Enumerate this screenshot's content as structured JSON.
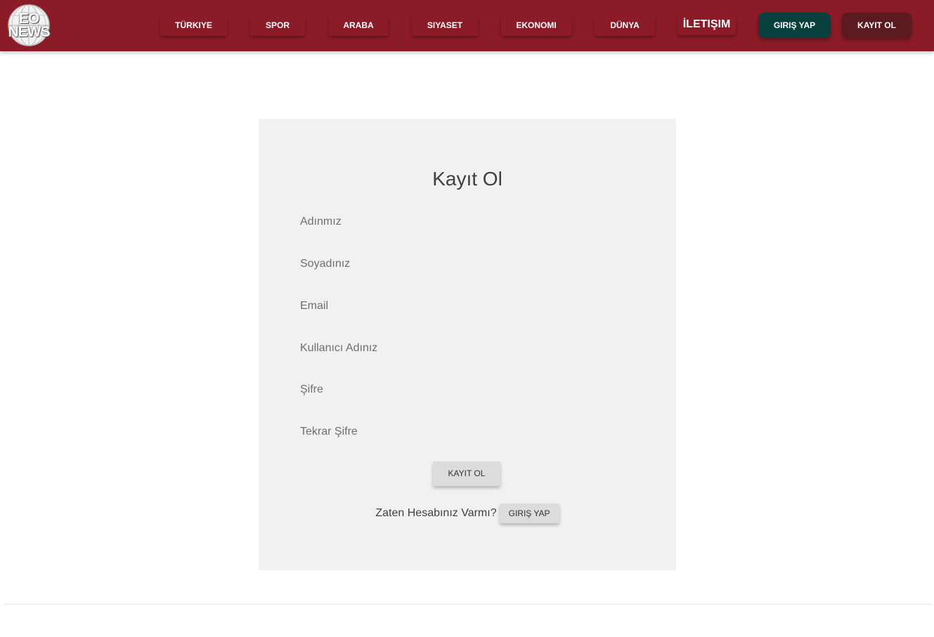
{
  "brand": {
    "logo_text_line1": "EO",
    "logo_text_line2": "NEWS"
  },
  "nav": {
    "items": [
      {
        "label": "TÜRKIYE"
      },
      {
        "label": "SPOR"
      },
      {
        "label": "ARABA"
      },
      {
        "label": "SIYASET"
      },
      {
        "label": "EKONOMI"
      },
      {
        "label": "DÜNYA"
      },
      {
        "label": "İLETIŞIM"
      }
    ],
    "login_label": "GIRIŞ YAP",
    "register_label": "KAYIT OL"
  },
  "form": {
    "title": "Kayıt Ol",
    "fields": [
      {
        "placeholder": "Adınmız",
        "value": ""
      },
      {
        "placeholder": "Soyadınız",
        "value": ""
      },
      {
        "placeholder": "Email",
        "value": ""
      },
      {
        "placeholder": "Kullanıcı Adınız",
        "value": ""
      },
      {
        "placeholder": "Şifre",
        "value": ""
      },
      {
        "placeholder": "Tekrar Şifre",
        "value": ""
      }
    ],
    "submit_label": "KAYIT OL",
    "have_account_text": "Zaten Hesabınız Varmı?",
    "login_label": "GIRIŞ YAP"
  },
  "colors": {
    "navbar": "#8b1c27",
    "login_button": "#08403e",
    "register_button": "#5b1a20",
    "card_background": "#f1f1f1"
  }
}
